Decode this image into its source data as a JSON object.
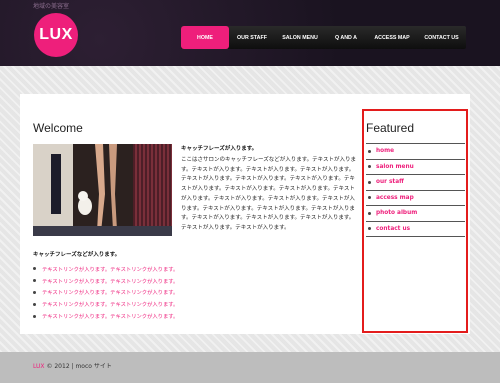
{
  "header": {
    "tagline": "地域の美容室",
    "logo": "LUX",
    "nav": [
      {
        "label": "HOME",
        "active": true
      },
      {
        "label": "OUR STAFF",
        "active": false
      },
      {
        "label": "SALON MENU",
        "active": false
      },
      {
        "label": "Q AND A",
        "active": false
      },
      {
        "label": "ACCESS MAP",
        "active": false
      },
      {
        "label": "CONTACT US",
        "active": false
      }
    ]
  },
  "main": {
    "title": "Welcome",
    "catchphrase": "キャッチフレーズが入ります。",
    "paragraph": "ここはさサロンのキャッチフレーズなどが入ります。テキストが入ります。テキストが入ります。テキストが入ります。テキストが入ります。テキストが入ります。テキストが入ります。テキストが入ります。テキストが入ります。テキストが入ります。テキストが入ります。テキストが入ります。テキストが入ります。テキストが入ります。テキストが入ります。テキストが入ります。テキストが入ります。テキストが入ります。テキストが入ります。テキストが入ります。テキストが入ります。テキストが入ります。テキストが入ります。",
    "catchphrase2": "キャッチフレーズなどが入ります。",
    "links": [
      "テキストリンクが入ります。テキストリンクが入ります。",
      "テキストリンクが入ります。テキストリンクが入ります。",
      "テキストリンクが入ります。テキストリンクが入ります。",
      "テキストリンクが入ります。テキストリンクが入ります。",
      "テキストリンクが入ります。テキストリンクが入ります。"
    ]
  },
  "sidebar": {
    "title": "Featured",
    "items": [
      "home",
      "salon menu",
      "our staff",
      "access map",
      "photo album",
      "contact us"
    ]
  },
  "footer": {
    "brand": "LUX",
    "text": " © 2012 | moco サイト"
  },
  "colors": {
    "accent": "#ee1f7b",
    "highlight_border": "#e31c1c"
  }
}
